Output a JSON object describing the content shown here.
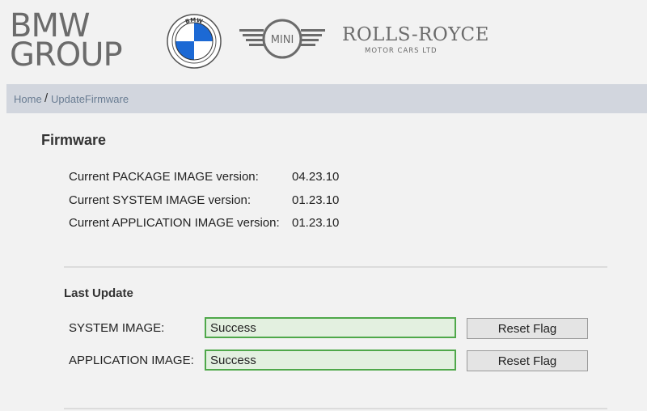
{
  "header": {
    "brand_group": [
      "BMW",
      "GROUP"
    ],
    "bmw_logo_text": "BMW",
    "mini_logo_text": "MINI",
    "rolls_royce": {
      "name": "ROLLS-ROYCE",
      "subtitle": "MOTOR CARS LTD"
    }
  },
  "breadcrumb": {
    "home": "Home",
    "separator": "/",
    "current": "UpdateFirmware"
  },
  "firmware": {
    "title": "Firmware",
    "versions": [
      {
        "label": "Current PACKAGE IMAGE version:",
        "value": "04.23.10"
      },
      {
        "label": "Current SYSTEM IMAGE version:",
        "value": "01.23.10"
      },
      {
        "label": "Current APPLICATION IMAGE version:",
        "value": "01.23.10"
      }
    ]
  },
  "last_update": {
    "title": "Last Update",
    "items": [
      {
        "label": "SYSTEM IMAGE:",
        "status": "Success",
        "button": "Reset Flag"
      },
      {
        "label": "APPLICATION IMAGE:",
        "status": "Success",
        "button": "Reset Flag"
      }
    ]
  },
  "colors": {
    "background": "#f2f2f2",
    "breadcrumb_bg": "#d2d6de",
    "breadcrumb_link": "#6a7d93",
    "success_border": "#4fa84a",
    "success_fill": "#e3f0e0",
    "bmw_blue": "#1c69d4"
  }
}
